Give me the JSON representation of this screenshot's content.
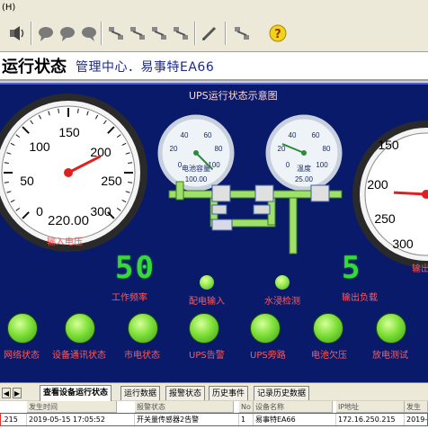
{
  "menu": {
    "fragment": "(H)"
  },
  "toolbar": {
    "buttons": [
      {
        "icon": "speaker-icon"
      },
      {
        "icon": "chat-bubble-icon"
      },
      {
        "icon": "chat-bubble-icon"
      },
      {
        "icon": "chat-bubble-icon"
      },
      {
        "icon": "network-tools-icon"
      },
      {
        "icon": "network-tools-icon"
      },
      {
        "icon": "network-tools-icon"
      },
      {
        "icon": "network-tools-icon"
      },
      {
        "icon": "pen-icon"
      },
      {
        "icon": "network-tools-icon"
      },
      {
        "icon": "help-icon"
      }
    ]
  },
  "header": {
    "title": "运行状态",
    "subtitle": "管理中心．易事特EA66"
  },
  "panel": {
    "diagram_title": "UPS运行状态示意图",
    "colors": {
      "background": "#0a1a6b",
      "led": "#35d93a",
      "label": "#ff5a5a",
      "indicator": "#7ee038"
    },
    "input_gauge": {
      "ticks": [
        "0",
        "50",
        "100",
        "150",
        "200",
        "250",
        "300"
      ],
      "readout": "220.00",
      "label": "输入电压",
      "value": 220
    },
    "battery_gauge": {
      "ticks": [
        "0",
        "20",
        "40",
        "60",
        "80",
        "100"
      ],
      "title": "电池容量",
      "readout": "100.00",
      "value": 100
    },
    "temp_gauge": {
      "ticks": [
        "0",
        "20",
        "40",
        "60",
        "80",
        "100"
      ],
      "title": "温度",
      "readout": "25.00",
      "value": 25
    },
    "output_gauge": {
      "ticks": [
        "150",
        "200",
        "250",
        "300"
      ],
      "label": "输出",
      "value": 220
    },
    "frequency": {
      "value": "50",
      "label": "工作频率"
    },
    "load": {
      "value": "5",
      "label": "输出负载"
    },
    "small_indicators": [
      {
        "label": "配电输入"
      },
      {
        "label": "水浸检测"
      }
    ],
    "status_indicators": [
      {
        "label": "网络状态"
      },
      {
        "label": "设备通讯状态"
      },
      {
        "label": "市电状态"
      },
      {
        "label": "UPS告警"
      },
      {
        "label": "UPS旁路"
      },
      {
        "label": "电池欠压"
      },
      {
        "label": "放电测试"
      }
    ]
  },
  "tabs": [
    {
      "label": "查看设备运行状态",
      "active": true
    },
    {
      "label": "运行数据",
      "active": false
    },
    {
      "label": "报警状态",
      "active": false
    },
    {
      "label": "历史事件",
      "active": false
    },
    {
      "label": "记录历史数据",
      "active": false
    }
  ],
  "left_table": {
    "headers": [
      "发生时间",
      "报警状态"
    ],
    "rows": [
      [
        "2019-05-15 17:05:52",
        "开关量传感器2告警"
      ]
    ],
    "first_col_fragment": ".215"
  },
  "right_table": {
    "headers": [
      "No",
      "设备名称",
      "IP地址",
      "发生"
    ],
    "rows": [
      [
        "1",
        "易事特EA66",
        "172.16.250.215",
        "2019-0"
      ]
    ]
  }
}
